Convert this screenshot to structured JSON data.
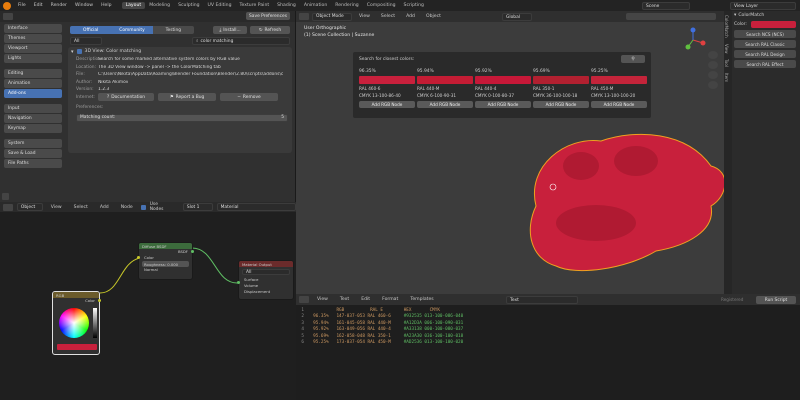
{
  "topbar": {
    "menus": [
      "File",
      "Edit",
      "Render",
      "Window",
      "Help"
    ],
    "workspaces": [
      "Layout",
      "Modeling",
      "Sculpting",
      "UV Editing",
      "Texture Paint",
      "Shading",
      "Animation",
      "Rendering",
      "Compositing",
      "Scripting"
    ],
    "active_workspace": "Layout",
    "scene": "Scene",
    "view_layer": "View Layer"
  },
  "prefs": {
    "save_button": "Save Preferences",
    "tabs": [
      "Official",
      "Community",
      "Testing"
    ],
    "install": "Install...",
    "refresh": "Refresh",
    "search_value": "color matching",
    "sidebar": [
      {
        "label": "Interface"
      },
      {
        "label": "Themes"
      },
      {
        "label": "Viewport"
      },
      {
        "label": "Lights"
      },
      {
        "label": "Editing"
      },
      {
        "label": "Animation"
      },
      {
        "label": "Add-ons",
        "active": true
      },
      {
        "label": "Input"
      },
      {
        "label": "Navigation"
      },
      {
        "label": "Keymap"
      },
      {
        "label": "System"
      },
      {
        "label": "Save & Load"
      },
      {
        "label": "File Paths"
      }
    ],
    "addon": {
      "name": "3D View: Color matching",
      "description": "Search for some marked alternative system colors by RGB value",
      "location": "The 3D View window -> panel -> the ColorMatching tab",
      "file": "C:\\Users\\Nikita\\AppData\\Roaming\\Blender Foundation\\Blender\\2.80\\scripts\\addons\\color_matching\\__init__.py",
      "author": "Nikita Akimov",
      "version": "1.2.3",
      "internet_label": "Internet:",
      "documentation": "Documentation",
      "report_bug": "Report a Bug",
      "remove": "Remove",
      "preferences_label": "Preferences:",
      "matching_count_label": "Matching count:",
      "matching_count_value": "5",
      "keys": {
        "description": "Description:",
        "location": "Location:",
        "file": "File:",
        "author": "Author:",
        "version": "Version:"
      }
    }
  },
  "node_editor": {
    "header": [
      "Object",
      "View",
      "Select",
      "Add",
      "Node"
    ],
    "use_nodes": "Use Nodes",
    "slot": "Slot 1",
    "material": "Material",
    "diffuse": {
      "title": "Diffuse BSDF",
      "out": "BSDF",
      "color": "Color",
      "roughness": "Roughness: 0.000",
      "normal": "Normal"
    },
    "output": {
      "title": "Material Output",
      "target": "All",
      "surface": "Surface",
      "volume": "Volume",
      "displacement": "Displacement"
    },
    "rgb": {
      "title": "RGB",
      "out": "Color",
      "swatch_color": "#c8203c"
    }
  },
  "viewport": {
    "header": {
      "mode": "Object Mode",
      "menus": [
        "View",
        "Select",
        "Add",
        "Object"
      ],
      "orientation": "Global"
    },
    "info_line1": "User Orthographic",
    "info_line2": "(1) Scene Collection | Suzanne",
    "colormatch": {
      "title": "Search for closest colors:",
      "results": [
        {
          "pct": "96.35%",
          "ral": "RAL 460-6",
          "cmyk": "CMYK 13-100-86-40",
          "button": "Add RGB Node",
          "color": "#c8203c"
        },
        {
          "pct": "95.94%",
          "ral": "RAL 440-M",
          "cmyk": "CMYK 6-100-90-31",
          "button": "Add RGB Node",
          "color": "#c41c34"
        },
        {
          "pct": "95.92%",
          "ral": "RAL 440-4",
          "cmyk": "CMYK 0-100-80-37",
          "button": "Add RGB Node",
          "color": "#c61838"
        },
        {
          "pct": "95.69%",
          "ral": "RAL 350-1",
          "cmyk": "CMYK 36-100-100-18",
          "button": "Add RGB Node",
          "color": "#b22030"
        },
        {
          "pct": "95.25%",
          "ral": "RAL 450-M",
          "cmyk": "CMYK 13-100-100-20",
          "button": "Add RGB Node",
          "color": "#c4243a"
        }
      ]
    }
  },
  "sidebar": {
    "title": "ColorMatch",
    "color_label": "Color:",
    "color_value": "#c8203c",
    "buttons": [
      "Search NCS (NCS)",
      "Search RAL Classic",
      "Search RAL Design",
      "Search RAL Effect"
    ],
    "tabs": [
      "Item",
      "Tool",
      "View",
      "ColorMatch"
    ]
  },
  "text_editor": {
    "header": [
      "View",
      "Text",
      "Edit",
      "Format",
      "Templates"
    ],
    "file": "Text",
    "run_script": "Run Script",
    "registered": "Registered",
    "lines": [
      {
        "n": "1",
        "a": "           RGB          RAL E        HEX       CMYK",
        "b": ""
      },
      {
        "n": "2",
        "a": "  96.35%   147-037-053 RAL 460-6     ",
        "b": "#932535 013-100-086-040"
      },
      {
        "n": "3",
        "a": "  95.94%   161-045-058 RAL 440-M     ",
        "b": "#A12D3A 006-100-090-031"
      },
      {
        "n": "4",
        "a": "  95.92%   163-049-056 RAL 440-4     ",
        "b": "#A33138 000-100-080-037"
      },
      {
        "n": "5",
        "a": "  95.69%   162-058-048 RAL 350-1     ",
        "b": "#A23A30 036-100-100-018"
      },
      {
        "n": "6",
        "a": "  95.25%   173-037-054 RAL 450-M     ",
        "b": "#AD2536 013-100-100-020"
      }
    ]
  }
}
